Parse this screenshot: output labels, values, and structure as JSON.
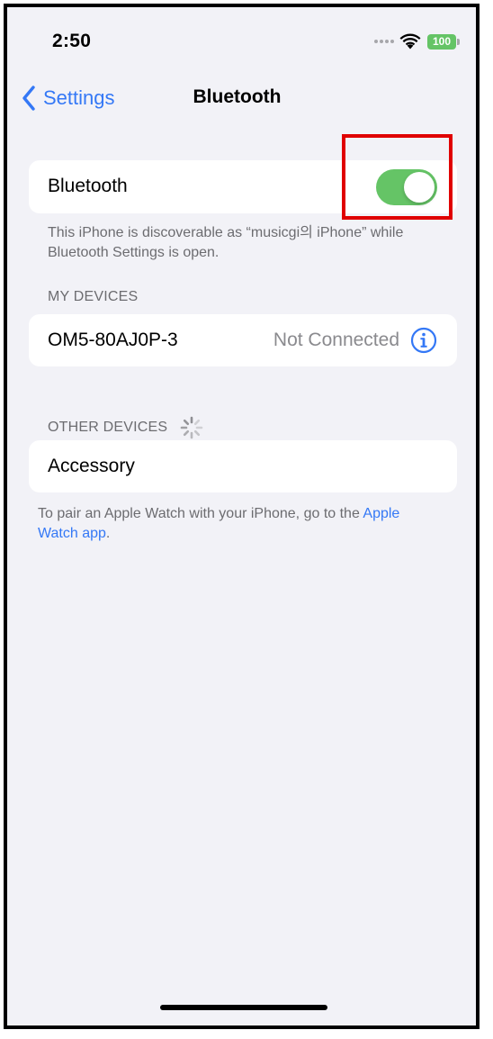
{
  "status_bar": {
    "time": "2:50",
    "battery": "100",
    "wifi_icon": "wifi-icon",
    "signal_icon": "signal-dots-icon"
  },
  "nav": {
    "back_label": "Settings",
    "back_icon": "chevron-left-icon",
    "title": "Bluetooth"
  },
  "bluetooth": {
    "label": "Bluetooth",
    "enabled": true,
    "discoverable_note": "This iPhone is discoverable as “musicgi의 iPhone” while Bluetooth Settings is open."
  },
  "my_devices": {
    "header": "MY DEVICES",
    "items": [
      {
        "name": "OM5-80AJ0P-3",
        "status": "Not Connected",
        "icon": "info-icon"
      }
    ]
  },
  "other_devices": {
    "header": "OTHER DEVICES",
    "spinner_icon": "loading-spinner-icon",
    "items": [
      {
        "name": "Accessory"
      }
    ]
  },
  "pair_note": {
    "text": "To pair an Apple Watch with your iPhone, go to the",
    "link": "Apple Watch app",
    "suffix": "."
  },
  "colors": {
    "accent": "#3478f6",
    "toggle_on": "#65c466",
    "background": "#f2f2f7",
    "highlight": "#e00000"
  }
}
